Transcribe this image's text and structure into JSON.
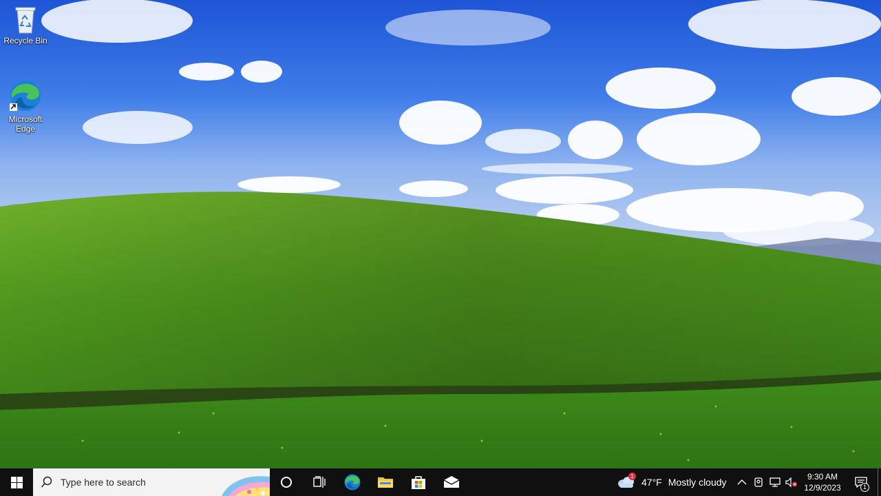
{
  "desktop": {
    "icons": [
      {
        "label": "Recycle Bin",
        "icon": "recycle-bin-icon"
      },
      {
        "label": "Microsoft\nEdge",
        "icon": "edge-icon"
      }
    ]
  },
  "taskbar": {
    "start_icon": "windows-logo-icon",
    "search": {
      "placeholder": "Type here to search",
      "icon": "search-icon"
    },
    "pinned": [
      {
        "name": "Cortana",
        "icon": "cortana-circle-icon"
      },
      {
        "name": "Task View",
        "icon": "task-view-icon"
      },
      {
        "name": "Microsoft Edge",
        "icon": "edge-icon"
      },
      {
        "name": "File Explorer",
        "icon": "folder-icon"
      },
      {
        "name": "Microsoft Store",
        "icon": "store-bag-icon"
      },
      {
        "name": "Mail",
        "icon": "mail-icon"
      }
    ],
    "weather": {
      "temp": "47°F",
      "condition": "Mostly cloudy",
      "badge": "1",
      "icon": "cloud-icon"
    },
    "tray": [
      {
        "icon": "chevron-up-icon"
      },
      {
        "icon": "meet-now-icon"
      },
      {
        "icon": "network-icon"
      },
      {
        "icon": "volume-muted-icon"
      }
    ],
    "clock": {
      "time": "9:30 AM",
      "date": "12/9/2023"
    },
    "notifications": {
      "badge": "1",
      "icon": "action-center-icon"
    }
  },
  "colors": {
    "taskbar": "#101010",
    "sky": "#2c6ae6",
    "grass": "#4f9a1e",
    "edge_blue": "#1e7fd6",
    "edge_green": "#48c25a"
  }
}
